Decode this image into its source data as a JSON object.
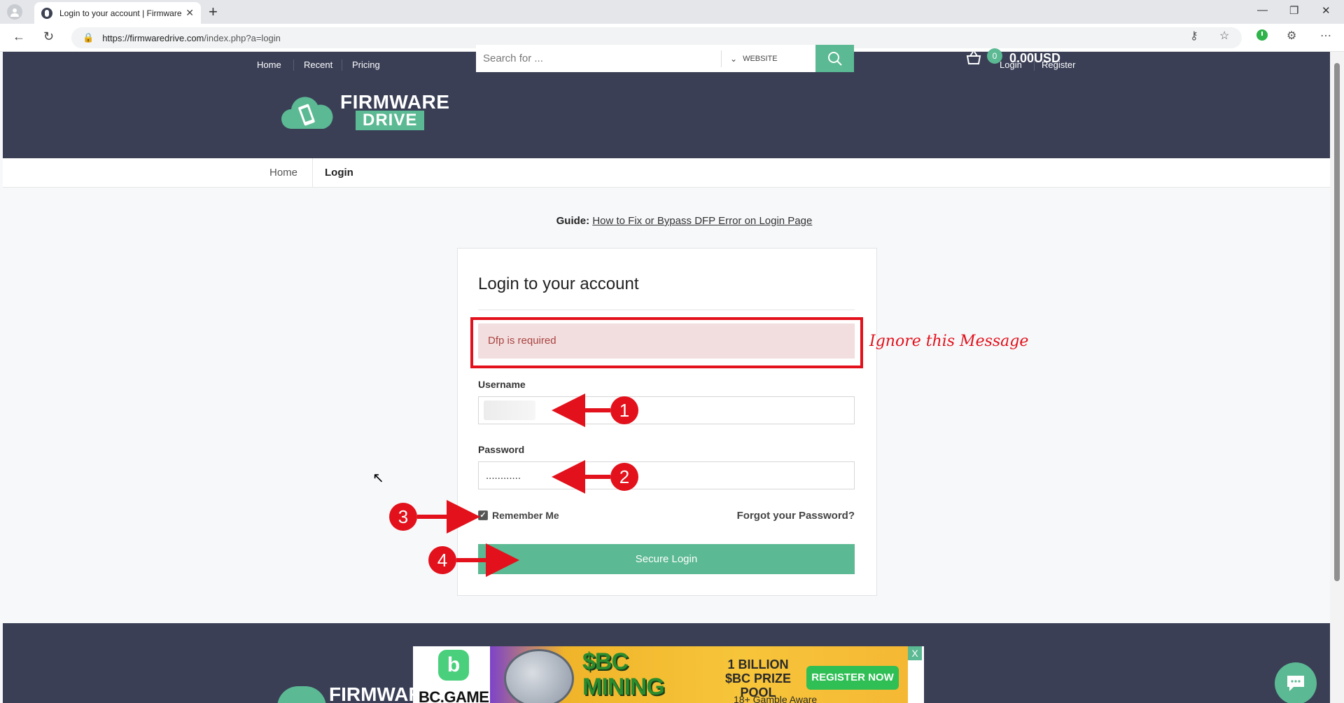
{
  "browser": {
    "tab_title": "Login to your account | Firmware",
    "new_tab": "+",
    "url_host": "https://firmwaredrive.com",
    "url_path": "/index.php?a=login"
  },
  "header": {
    "nav": [
      "Home",
      "Recent",
      "Pricing"
    ],
    "auth": [
      "Login",
      "Register"
    ],
    "brand_line1": "FIRMWARE",
    "brand_line2": "DRIVE",
    "search_placeholder": "Search for ...",
    "search_scope": "WEBSITE",
    "cart_count": "0",
    "cart_total": "0.00USD"
  },
  "breadcrumb": [
    "Home",
    "Login"
  ],
  "guide": {
    "label": "Guide:",
    "link": "How to Fix or Bypass DFP Error on Login Page"
  },
  "login": {
    "title": "Login to your account",
    "alert": "Dfp is required",
    "username_label": "Username",
    "password_label": "Password",
    "password_value": "............",
    "remember_label": "Remember Me",
    "remember_checked": true,
    "forgot": "Forgot your Password?",
    "submit": "Secure Login"
  },
  "annotations": {
    "note": "Ignore this Message",
    "steps": [
      "1",
      "2",
      "3",
      "4"
    ],
    "color": "#e2111b"
  },
  "footer": {
    "brand": "FIRMWARE"
  },
  "ad": {
    "logo_letter": "b",
    "brand": "BC.GAME",
    "headline": "$BC MINING RUSH!",
    "prize": "1 BILLION $BC PRIZE POOL",
    "cta": "REGISTER NOW",
    "age": "18+ Gamble Aware",
    "close": "X"
  },
  "colors": {
    "header_bg": "#3a3f56",
    "accent": "#5bb993",
    "alert_bg": "#f2dede",
    "alert_text": "#a94442"
  }
}
